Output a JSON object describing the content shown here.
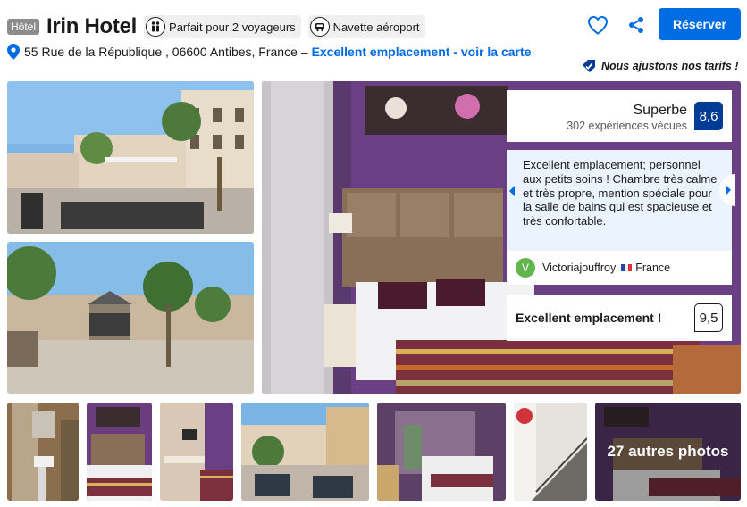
{
  "header": {
    "type_badge": "Hôtel",
    "hotel_name": "Irin Hotel",
    "facilities": [
      {
        "icon": "couple-icon",
        "label": "Parfait pour 2 voyageurs"
      },
      {
        "icon": "shuttle-icon",
        "label": "Navette aéroport"
      }
    ],
    "address": "55 Rue de la République , 06600 Antibes, France –",
    "location_link": "Excellent emplacement - voir la carte",
    "reserve_label": "Réserver",
    "price_match": "Nous ajustons nos tarifs !",
    "colors": {
      "brand_blue": "#006ce4",
      "score_blue": "#003b95",
      "accent_green": "#62b54c"
    }
  },
  "review": {
    "score_word": "Superbe",
    "review_count": "302 expériences vécues",
    "score": "8,6",
    "text": "Excellent emplacement; personnel aux petits soins ! Chambre très calme et très propre, mention spéciale pour la salle de bains qui est spacieuse et très confortable.",
    "reviewer_initial": "V",
    "reviewer_name": "Victoriajouffroy",
    "reviewer_country": "France"
  },
  "location": {
    "label": "Excellent emplacement !",
    "score": "9,5"
  },
  "gallery": {
    "more_photos": "27 autres photos"
  }
}
